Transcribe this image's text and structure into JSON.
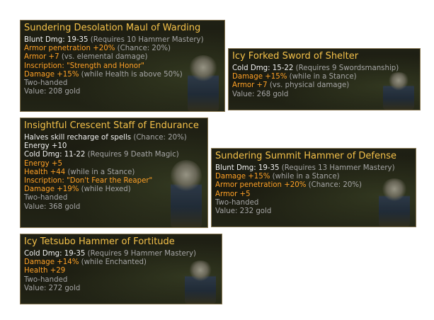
{
  "tooltips": [
    {
      "id": "tt1",
      "title": "Sundering Desolation Maul of Warding",
      "lines": [
        {
          "main": "Blunt Dmg: 19-35",
          "note": " (Requires 10 Hammer Mastery)",
          "color": "white"
        },
        {
          "main": "Armor penetration +20%",
          "note": " (Chance: 20%)",
          "color": "orange"
        },
        {
          "main": "Armor +7",
          "note": " (vs. elemental damage)",
          "color": "orange"
        },
        {
          "main": "Inscription: \"Strength and Honor\"",
          "note": "",
          "color": "orange"
        },
        {
          "main": "Damage +15%",
          "note": " (while Health is above 50%)",
          "color": "orange"
        },
        {
          "main": "Two-handed",
          "note": "",
          "color": "gray"
        },
        {
          "main": "Value: 208 gold",
          "note": "",
          "color": "gray"
        }
      ]
    },
    {
      "id": "tt2",
      "title": "Icy Forked Sword of Shelter",
      "lines": [
        {
          "main": "Cold Dmg: 15-22",
          "note": " (Requires 9 Swordsmanship)",
          "color": "white"
        },
        {
          "main": "Damage +15%",
          "note": " (while in a Stance)",
          "color": "orange"
        },
        {
          "main": "Armor +7",
          "note": " (vs. physical damage)",
          "color": "orange"
        },
        {
          "main": "Value: 268 gold",
          "note": "",
          "color": "gray"
        }
      ]
    },
    {
      "id": "tt3",
      "title": "Insightful Crescent Staff of Endurance",
      "lines": [
        {
          "main": "Halves skill recharge of spells",
          "note": " (Chance: 20%)",
          "color": "white"
        },
        {
          "main": "Energy +10",
          "note": "",
          "color": "white"
        },
        {
          "main": "Cold Dmg: 11-22",
          "note": " (Requires 9 Death Magic)",
          "color": "white"
        },
        {
          "main": "Energy +5",
          "note": "",
          "color": "orange"
        },
        {
          "main": "Health +44",
          "note": " (while in a Stance)",
          "color": "orange"
        },
        {
          "main": "Inscription: \"Don't Fear the Reaper\"",
          "note": "",
          "color": "orange"
        },
        {
          "main": "Damage +19%",
          "note": " (while Hexed)",
          "color": "orange"
        },
        {
          "main": "Two-handed",
          "note": "",
          "color": "gray"
        },
        {
          "main": "Value: 368 gold",
          "note": "",
          "color": "gray"
        }
      ]
    },
    {
      "id": "tt4",
      "title": "Sundering Summit Hammer of Defense",
      "lines": [
        {
          "main": "Blunt Dmg: 19-35",
          "note": " (Requires 13 Hammer Mastery)",
          "color": "white"
        },
        {
          "main": "Damage +15%",
          "note": " (while in a Stance)",
          "color": "orange"
        },
        {
          "main": "Armor penetration +20%",
          "note": " (Chance: 20%)",
          "color": "orange"
        },
        {
          "main": "Armor +5",
          "note": "",
          "color": "orange"
        },
        {
          "main": "Two-handed",
          "note": "",
          "color": "gray"
        },
        {
          "main": "Value: 232 gold",
          "note": "",
          "color": "gray"
        }
      ]
    },
    {
      "id": "tt5",
      "title": "Icy Tetsubo Hammer of Fortitude",
      "lines": [
        {
          "main": "Cold Dmg: 19-35",
          "note": " (Requires 9 Hammer Mastery)",
          "color": "white"
        },
        {
          "main": "Damage +14%",
          "note": " (while Enchanted)",
          "color": "orange"
        },
        {
          "main": "Health +29",
          "note": "",
          "color": "orange"
        },
        {
          "main": "Two-handed",
          "note": "",
          "color": "gray"
        },
        {
          "main": "Value: 272 gold",
          "note": "",
          "color": "gray"
        }
      ]
    }
  ],
  "colors": {
    "title": "#f5c24a",
    "white": "#f2f2f2",
    "orange": "#ffa126",
    "gray": "#a5a5a5",
    "note_gray": "#a5a5a5",
    "border": "#8a7a55"
  }
}
